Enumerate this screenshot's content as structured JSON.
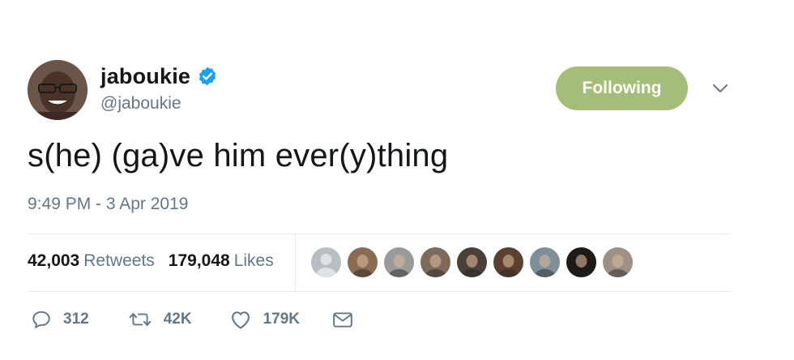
{
  "author": {
    "display_name": "jaboukie",
    "handle": "@jaboukie",
    "verified": true,
    "avatar_icon": "profile-photo"
  },
  "follow_button": {
    "label": "Following",
    "color": "#a4be79"
  },
  "menu": {
    "icon": "chevron-down-icon"
  },
  "tweet": {
    "text": "s(he) (ga)ve him ever(y)thing",
    "timestamp": "9:49 PM - 3 Apr 2019"
  },
  "stats": {
    "retweets_count": "42,003",
    "retweets_label": "Retweets",
    "likes_count": "179,048",
    "likes_label": "Likes"
  },
  "likers": [
    {
      "name": "liker-avatar-1",
      "color": "#b8bec4"
    },
    {
      "name": "liker-avatar-2",
      "color": "#8a6c52"
    },
    {
      "name": "liker-avatar-3",
      "color": "#9a9a9a"
    },
    {
      "name": "liker-avatar-4",
      "color": "#7d6a58"
    },
    {
      "name": "liker-avatar-5",
      "color": "#4a4038"
    },
    {
      "name": "liker-avatar-6",
      "color": "#5b4030"
    },
    {
      "name": "liker-avatar-7",
      "color": "#7e8f9c"
    },
    {
      "name": "liker-avatar-8",
      "color": "#1e1a18"
    },
    {
      "name": "liker-avatar-9",
      "color": "#9d9186"
    }
  ],
  "actions": {
    "reply_count": "312",
    "retweet_count": "42K",
    "like_count": "179K",
    "message_icon": "envelope-icon"
  },
  "colors": {
    "text": "#14171a",
    "muted": "#657786",
    "verified_badge": "#1da1f2",
    "divider": "#e6ecf0"
  }
}
